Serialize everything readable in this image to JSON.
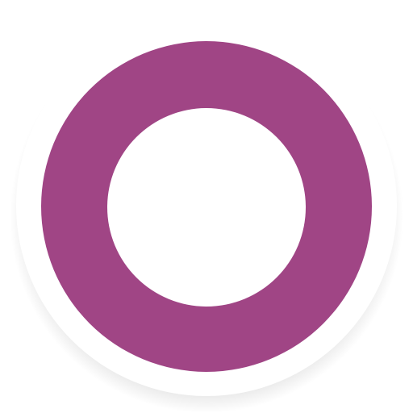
{
  "icon": {
    "name": "purple-ring-app-icon",
    "colors": {
      "ring": "#a04585",
      "plate": "#ffffff",
      "center": "#ffffff",
      "shadow": "#000000",
      "background": "#ffffff"
    }
  }
}
